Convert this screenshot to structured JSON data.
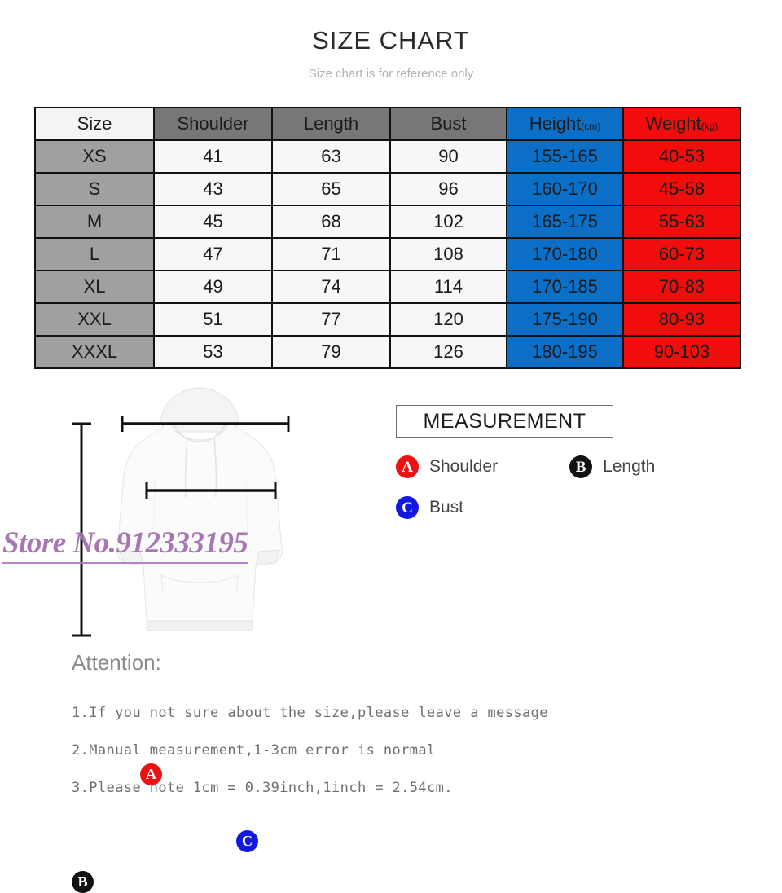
{
  "header": {
    "title": "SIZE CHART",
    "subtitle": "Size chart is for reference only"
  },
  "chart_data": {
    "type": "table",
    "title": "SIZE CHART",
    "columns": [
      "Size",
      "Shoulder",
      "Length",
      "Bust",
      "Height",
      "Weight"
    ],
    "column_units": [
      "",
      "",
      "",
      "",
      "(cm)",
      "(kg)"
    ],
    "column_headers_display": [
      "Size",
      "Shoulder",
      "Length",
      "Bust",
      "Height(cm)",
      "Weight(kg)"
    ],
    "rows": [
      {
        "size": "XS",
        "shoulder": "41",
        "length": "63",
        "bust": "90",
        "height": "155-165",
        "weight": "40-53"
      },
      {
        "size": "S",
        "shoulder": "43",
        "length": "65",
        "bust": "96",
        "height": "160-170",
        "weight": "45-58"
      },
      {
        "size": "M",
        "shoulder": "45",
        "length": "68",
        "bust": "102",
        "height": "165-175",
        "weight": "55-63"
      },
      {
        "size": "L",
        "shoulder": "47",
        "length": "71",
        "bust": "108",
        "height": "170-180",
        "weight": "60-73"
      },
      {
        "size": "XL",
        "shoulder": "49",
        "length": "74",
        "bust": "114",
        "height": "170-185",
        "weight": "70-83"
      },
      {
        "size": "XXL",
        "shoulder": "51",
        "length": "77",
        "bust": "120",
        "height": "175-190",
        "weight": "80-93"
      },
      {
        "size": "XXXL",
        "shoulder": "53",
        "length": "79",
        "bust": "126",
        "height": "180-195",
        "weight": "90-103"
      }
    ],
    "colors": {
      "header_gray": "#777777",
      "header_size": "#f4f4f4",
      "height_blue": "#0b6fc8",
      "weight_red": "#f20d0d",
      "size_cell_gray": "#a0a0a0",
      "plain_cell": "#f7f7f7",
      "border": "#111111"
    }
  },
  "figure": {
    "watermark": "Store No.912333195",
    "marker_a": "A",
    "marker_b": "B",
    "marker_c": "C"
  },
  "measurement": {
    "title": "MEASUREMENT",
    "legend": [
      {
        "badge": "A",
        "label": "Shoulder",
        "color": "#ee1111"
      },
      {
        "badge": "B",
        "label": "Length",
        "color": "#111111"
      },
      {
        "badge": "C",
        "label": "Bust",
        "color": "#1318e0"
      }
    ]
  },
  "attention": {
    "heading": "Attention:",
    "items": [
      "1.If you not sure about the size,please leave a message",
      "2.Manual measurement,1-3cm error is normal",
      "3.Please note 1cm = 0.39inch,1inch = 2.54cm."
    ]
  }
}
